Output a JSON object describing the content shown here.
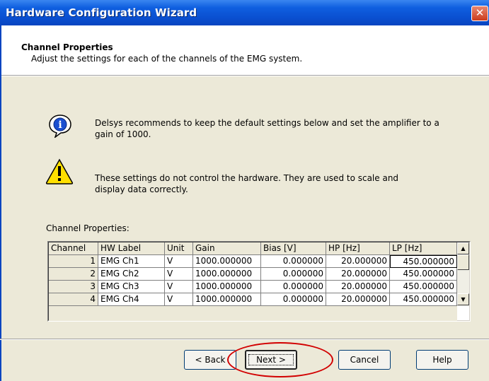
{
  "window": {
    "title": "Hardware Configuration Wizard",
    "close_glyph": "✕"
  },
  "header": {
    "title": "Channel Properties",
    "subtitle": "Adjust the settings for each of the channels of the EMG system."
  },
  "notes": {
    "info_text_1": "Delsys recommends to keep the default settings below and set the amplifier to a",
    "info_text_2": "gain of 1000.",
    "warning_text_1": "These settings do not control the hardware. They are used to scale and",
    "warning_text_2": "display data correctly."
  },
  "grid": {
    "label": "Channel Properties:",
    "columns": [
      "Channel",
      "HW Label",
      "Unit",
      "Gain",
      "Bias [V]",
      "HP [Hz]",
      "LP [Hz]"
    ],
    "rows": [
      [
        "1",
        "EMG Ch1",
        "V",
        "1000.000000",
        "0.000000",
        "20.000000",
        "450.000000"
      ],
      [
        "2",
        "EMG Ch2",
        "V",
        "1000.000000",
        "0.000000",
        "20.000000",
        "450.000000"
      ],
      [
        "3",
        "EMG Ch3",
        "V",
        "1000.000000",
        "0.000000",
        "20.000000",
        "450.000000"
      ],
      [
        "4",
        "EMG Ch4",
        "V",
        "1000.000000",
        "0.000000",
        "20.000000",
        "450.000000"
      ]
    ],
    "scroll_up_glyph": "▲",
    "scroll_down_glyph": "▼"
  },
  "buttons": {
    "back": "< Back",
    "next": "Next >",
    "cancel": "Cancel",
    "help": "Help"
  },
  "icons": {
    "info": "info-icon",
    "warning": "warning-icon"
  },
  "colors": {
    "titlebar": "#0a4fd0",
    "highlight": "#d20000"
  }
}
